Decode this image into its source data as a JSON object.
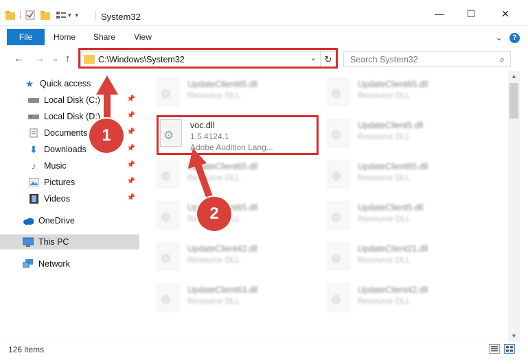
{
  "window": {
    "title": "System32",
    "minimize_glyph": "—",
    "maximize_glyph": "☐",
    "close_glyph": "✕"
  },
  "ribbon": {
    "tabs": [
      {
        "label": "File"
      },
      {
        "label": "Home"
      },
      {
        "label": "Share"
      },
      {
        "label": "View"
      }
    ],
    "expand_glyph": "⌄",
    "help_glyph": "?"
  },
  "address": {
    "path": "C:\\Windows\\System32",
    "search_placeholder": "Search System32",
    "dropdown_glyph": "⌄",
    "refresh_glyph": "↻"
  },
  "sidebar": {
    "items": [
      {
        "label": "Quick access",
        "icon": "star-icon",
        "pinned": false
      },
      {
        "label": "Local Disk (C:)",
        "icon": "drive-icon",
        "pinned": true
      },
      {
        "label": "Local Disk (D:)",
        "icon": "drive-icon",
        "pinned": true
      },
      {
        "label": "Documents",
        "icon": "documents-icon",
        "pinned": true
      },
      {
        "label": "Downloads",
        "icon": "download-icon",
        "pinned": true
      },
      {
        "label": "Music",
        "icon": "music-icon",
        "pinned": true
      },
      {
        "label": "Pictures",
        "icon": "pictures-icon",
        "pinned": true
      },
      {
        "label": "Videos",
        "icon": "videos-icon",
        "pinned": true
      },
      {
        "label": "OneDrive",
        "icon": "cloud-icon",
        "pinned": false
      },
      {
        "label": "This PC",
        "icon": "computer-icon",
        "pinned": false,
        "selected": true
      },
      {
        "label": "Network",
        "icon": "network-icon",
        "pinned": false
      }
    ],
    "pin_glyph": "📌"
  },
  "files": {
    "left_column": [
      {
        "name": "UpdateClient65.dll",
        "type": "Resource DLL"
      },
      {
        "name": "voc.dll",
        "version": "1.5.4124.1",
        "description": "Adobe Audition Lang..."
      },
      {
        "name": "UpdateClient65.dll",
        "type": "Resource DLL"
      },
      {
        "name": "UpdateClient65.dll",
        "type": "Resource DLL"
      },
      {
        "name": "UpdateClient42.dll",
        "type": "Resource DLL"
      },
      {
        "name": "UpdateClient63.dll",
        "type": "Resource DLL"
      }
    ],
    "right_column": [
      {
        "name": "UpdateClient65.dll",
        "type": "Resource DLL"
      },
      {
        "name": "UpdateClient5.dll",
        "type": "Resource DLL"
      },
      {
        "name": "UpdateClient65.dll",
        "type": "Resource DLL"
      },
      {
        "name": "UpdateClient5.dll",
        "type": "Resource DLL"
      },
      {
        "name": "UpdateClient21.dll",
        "type": "Resource DLL"
      },
      {
        "name": "UpdateClient42.dll",
        "type": "Resource DLL"
      }
    ]
  },
  "status": {
    "item_count": "126 items"
  },
  "annotations": {
    "badge_1": "1",
    "badge_2": "2",
    "highlight_color": "#d72d2d",
    "badge_color": "#d9403a"
  }
}
